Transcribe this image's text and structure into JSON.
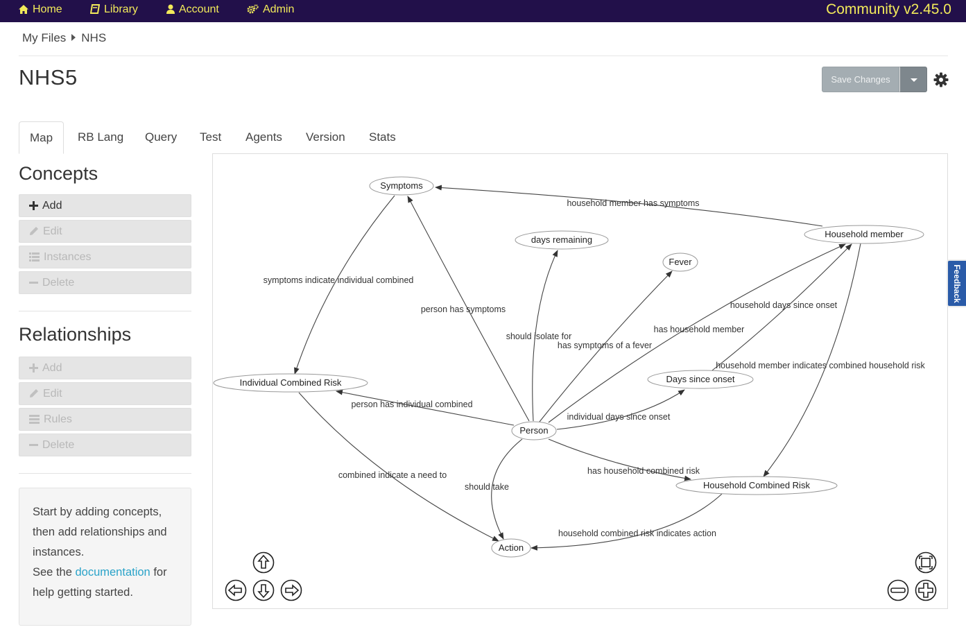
{
  "nav": {
    "items": [
      {
        "label": "Home",
        "icon": "home-icon"
      },
      {
        "label": "Library",
        "icon": "book-icon"
      },
      {
        "label": "Account",
        "icon": "user-icon"
      },
      {
        "label": "Admin",
        "icon": "cogs-icon"
      }
    ],
    "brand": "Community v2.45.0"
  },
  "breadcrumb": {
    "root": "My Files",
    "current": "NHS"
  },
  "page": {
    "title": "NHS5"
  },
  "toolbar": {
    "save_label": "Save Changes"
  },
  "tabs": [
    "Map",
    "RB Lang",
    "Query",
    "Test",
    "Agents",
    "Version",
    "Stats"
  ],
  "concepts": {
    "title": "Concepts",
    "buttons": [
      "Add",
      "Edit",
      "Instances",
      "Delete"
    ]
  },
  "relationships": {
    "title": "Relationships",
    "buttons": [
      "Add",
      "Edit",
      "Rules",
      "Delete"
    ]
  },
  "help": {
    "line1": "Start by adding concepts, then add relationships and instances.",
    "see": "See the",
    "link": "documentation",
    "rest": "for help getting started."
  },
  "graph": {
    "nodes": [
      {
        "id": "symptoms",
        "label": "Symptoms"
      },
      {
        "id": "days_remaining",
        "label": "days remaining"
      },
      {
        "id": "fever",
        "label": "Fever"
      },
      {
        "id": "household_member",
        "label": "Household member"
      },
      {
        "id": "individual_combined_risk",
        "label": "Individual Combined Risk"
      },
      {
        "id": "days_since_onset",
        "label": "Days since onset"
      },
      {
        "id": "person",
        "label": "Person"
      },
      {
        "id": "household_combined_risk",
        "label": "Household Combined Risk"
      },
      {
        "id": "action",
        "label": "Action"
      }
    ],
    "edges": [
      {
        "label": "household member has symptoms"
      },
      {
        "label": "symptoms indicate individual combined"
      },
      {
        "label": "person has symptoms"
      },
      {
        "label": "should isolate for"
      },
      {
        "label": "has symptoms of a fever"
      },
      {
        "label": "household days since onset"
      },
      {
        "label": "has household member"
      },
      {
        "label": "household member indicates combined household risk"
      },
      {
        "label": "person has individual combined"
      },
      {
        "label": "individual days since onset"
      },
      {
        "label": "combined indicate a need to"
      },
      {
        "label": "should take"
      },
      {
        "label": "has household combined risk"
      },
      {
        "label": "household combined risk indicates action"
      }
    ]
  },
  "feedback": "Feedback",
  "colors": {
    "navbar": "#22104a",
    "brand": "#f2ea5a",
    "link": "#2aa3c9",
    "save_button": "#a4adb2"
  }
}
